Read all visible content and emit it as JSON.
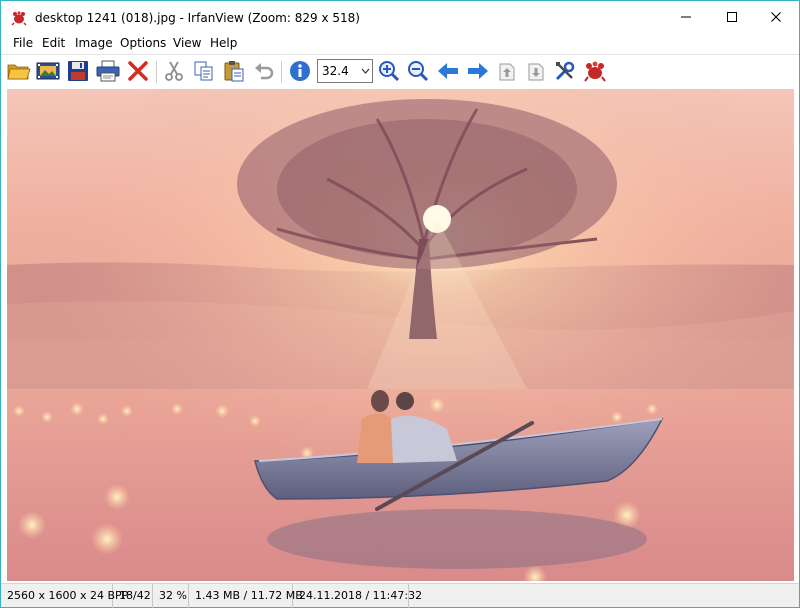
{
  "window": {
    "title": "desktop 1241 (018).jpg - IrfanView (Zoom: 829 x 518)",
    "accent_color": "#35b3c6"
  },
  "menu": {
    "items": [
      {
        "label": "File"
      },
      {
        "label": "Edit"
      },
      {
        "label": "Image"
      },
      {
        "label": "Options"
      },
      {
        "label": "View"
      },
      {
        "label": "Help"
      }
    ]
  },
  "toolbar": {
    "buttons": [
      {
        "icon": "open-folder-icon"
      },
      {
        "icon": "slideshow-icon"
      },
      {
        "icon": "save-icon"
      },
      {
        "icon": "print-icon"
      },
      {
        "icon": "delete-icon"
      },
      {
        "icon": "cut-icon"
      },
      {
        "icon": "copy-icon"
      },
      {
        "icon": "paste-icon"
      },
      {
        "icon": "undo-icon"
      },
      {
        "icon": "info-icon"
      },
      {
        "icon": "zoom-in-icon"
      },
      {
        "icon": "zoom-out-icon"
      },
      {
        "icon": "previous-icon"
      },
      {
        "icon": "next-icon"
      },
      {
        "icon": "first-page-icon"
      },
      {
        "icon": "last-page-icon"
      },
      {
        "icon": "settings-icon"
      },
      {
        "icon": "irfanview-logo-icon"
      }
    ],
    "zoom_value": "32.4"
  },
  "statusbar": {
    "dimensions": "2560 x 1600 x 24 BPP",
    "index": "18/42",
    "zoom_percent": "32 %",
    "file_size": "1.43 MB / 11.72 MB",
    "date_time": "24.11.2018 / 11:47:32"
  },
  "colors": {
    "sky": "#f1b3a2",
    "water": "#e49a93",
    "tree": "#7a4855",
    "boat": "#7d7f9c",
    "sun": "#fff6d0"
  }
}
